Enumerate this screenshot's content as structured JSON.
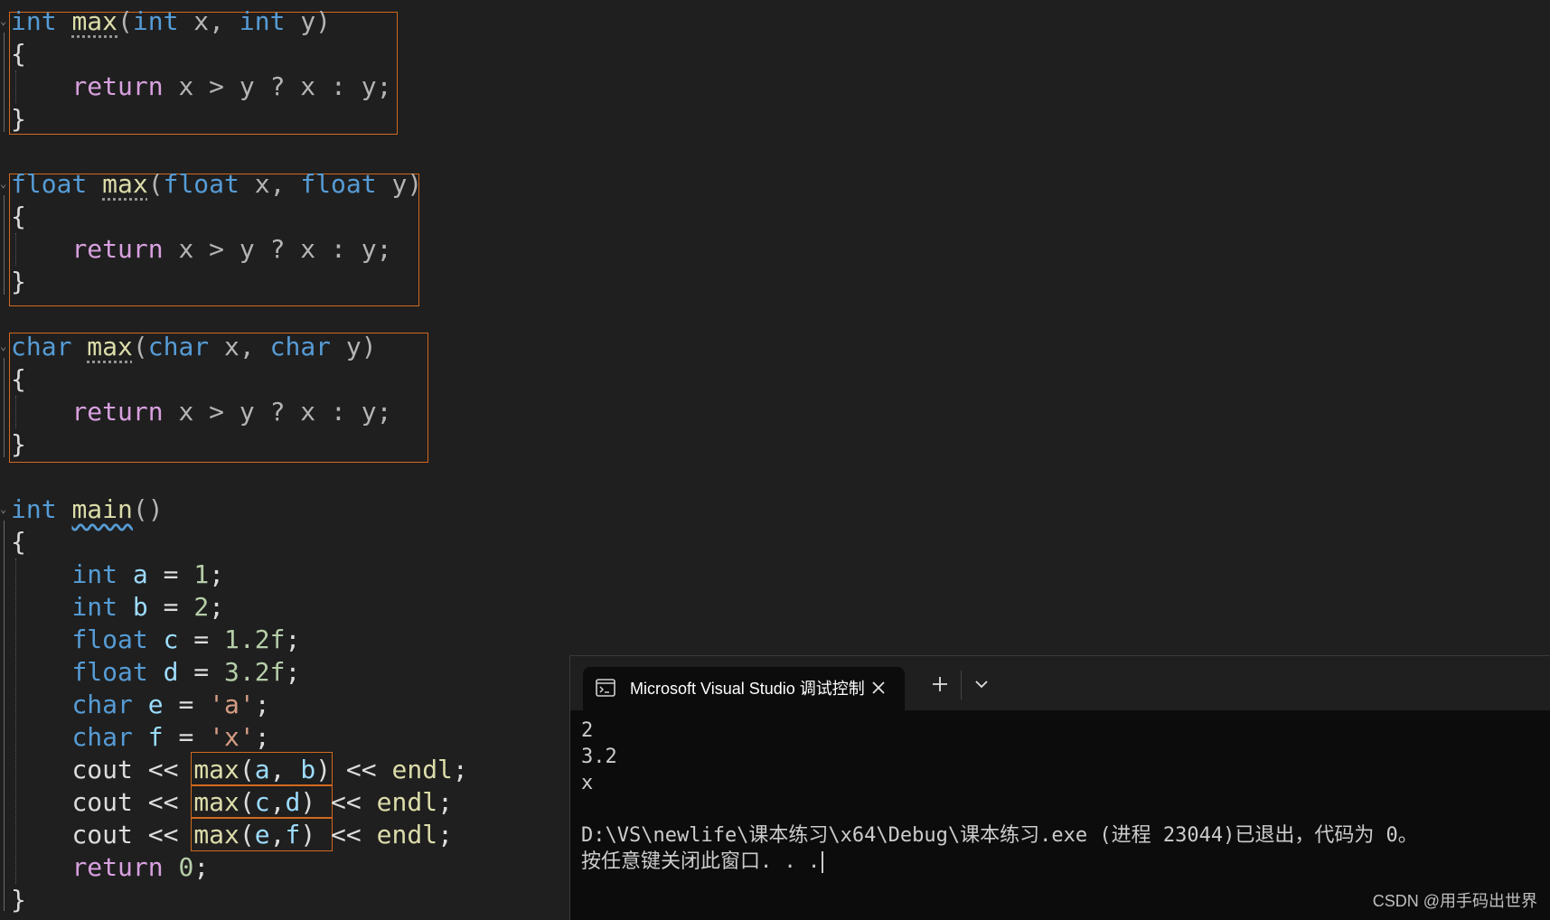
{
  "editor": {
    "colors": {
      "background": "#1f1f1f",
      "keyword": "#569cd6",
      "control": "#d8a0df",
      "function": "#dcdcaa",
      "variable": "#9cdcfe",
      "number": "#b5cea8",
      "string": "#d69d85",
      "highlight_box": "#d2691e"
    },
    "int_max": {
      "t_int": "int",
      "t_max": "max",
      "t_open": "(",
      "t_int2": "int",
      "t_x": " x, ",
      "t_int3": "int",
      "t_y": " y)",
      "brace_open": "{",
      "r_return": "return",
      "r_expr": " x > y ? x : y;",
      "brace_close": "}"
    },
    "float_max": {
      "t_float": "float",
      "t_max": "max",
      "t_open": "(",
      "t_float2": "float",
      "t_x": " x, ",
      "t_float3": "float",
      "t_y": " y)",
      "brace_open": "{",
      "r_return": "return",
      "r_expr": " x > y ? x : y;",
      "brace_close": "}"
    },
    "char_max": {
      "t_char": "char",
      "t_max": "max",
      "t_open": "(",
      "t_char2": "char",
      "t_x": " x, ",
      "t_char3": "char",
      "t_y": " y)",
      "brace_open": "{",
      "r_return": "return",
      "r_expr": " x > y ? x : y;",
      "brace_close": "}"
    },
    "main": {
      "t_int": "int",
      "t_main": "main",
      "t_parens": "()",
      "brace_open": "{",
      "l1": {
        "type": "int",
        "name": "a",
        "eq": " = ",
        "val": "1",
        "end": ";"
      },
      "l2": {
        "type": "int",
        "name": "b",
        "eq": " = ",
        "val": "2",
        "end": ";"
      },
      "l3": {
        "type": "float",
        "name": "c",
        "eq": " = ",
        "val": "1.2f",
        "end": ";"
      },
      "l4": {
        "type": "float",
        "name": "d",
        "eq": " = ",
        "val": "3.2f",
        "end": ";"
      },
      "l5": {
        "type": "char",
        "name": "e",
        "eq": " = ",
        "val": "'a'",
        "end": ";"
      },
      "l6": {
        "type": "char",
        "name": "f",
        "eq": " = ",
        "val": "'x'",
        "end": ";"
      },
      "c1": {
        "cout": "cout",
        "op": " << ",
        "fn": "max",
        "p1": "(",
        "a1": "a",
        "sep": ", ",
        "a2": "b",
        "p2": ")",
        "op2": " << ",
        "endl": "endl",
        "end": ";"
      },
      "c2": {
        "cout": "cout",
        "op": " << ",
        "fn": "max",
        "p1": "(",
        "a1": "c",
        "sep": ",",
        "a2": "d",
        "p2": ")",
        "op2": " << ",
        "endl": "endl",
        "end": ";"
      },
      "c3": {
        "cout": "cout",
        "op": " << ",
        "fn": "max",
        "p1": "(",
        "a1": "e",
        "sep": ",",
        "a2": "f",
        "p2": ")",
        "op2": " << ",
        "endl": "endl",
        "end": ";"
      },
      "ret": {
        "kw": "return",
        "val": "0",
        "end": ";"
      },
      "brace_close": "}"
    }
  },
  "terminal": {
    "tab_title": "Microsoft Visual Studio 调试控制台",
    "tab_icon": "console-icon",
    "close_icon": "close-icon",
    "new_tab_icon": "plus-icon",
    "dropdown_icon": "chevron-down-icon",
    "output": [
      "2",
      "3.2",
      "x",
      "",
      "D:\\VS\\newlife\\课本练习\\x64\\Debug\\课本练习.exe (进程 23044)已退出，代码为 0。",
      "按任意键关闭此窗口. . ."
    ]
  },
  "watermark": "CSDN @用手码出世界"
}
